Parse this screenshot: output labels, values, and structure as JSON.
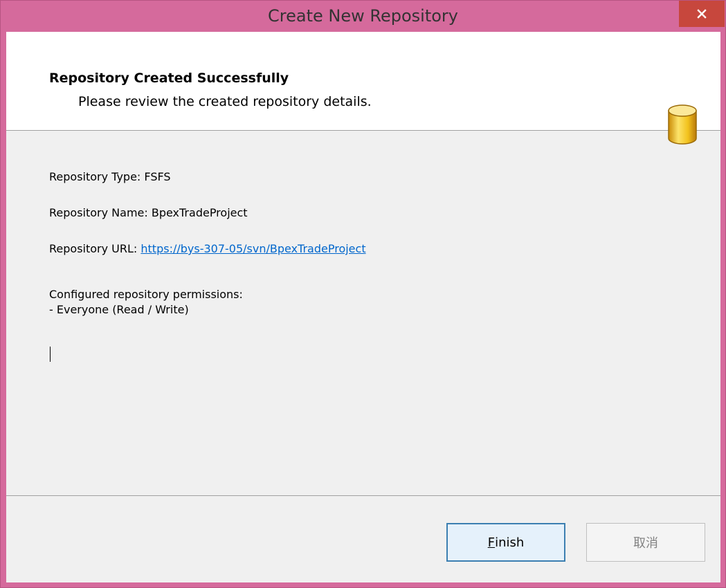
{
  "window": {
    "title": "Create New Repository",
    "close_icon": "close-icon"
  },
  "header": {
    "title": "Repository Created Successfully",
    "subtitle": "Please review the created repository details.",
    "icon": "database-icon"
  },
  "details": {
    "type_label": "Repository Type: FSFS",
    "name_label": "Repository Name: BpexTradeProject",
    "url_prefix": "Repository URL: ",
    "url": "https://bys-307-05/svn/BpexTradeProject",
    "permissions_heading": "Configured repository permissions:",
    "permissions": [
      "- Everyone (Read / Write)"
    ]
  },
  "buttons": {
    "finish_mnemonic": "F",
    "finish_rest": "inish",
    "cancel": "取消"
  },
  "colors": {
    "titlebar": "#d56a9c",
    "close_button": "#c7473d",
    "link": "#0066cc",
    "icon_yellow": "#f2c21d"
  }
}
